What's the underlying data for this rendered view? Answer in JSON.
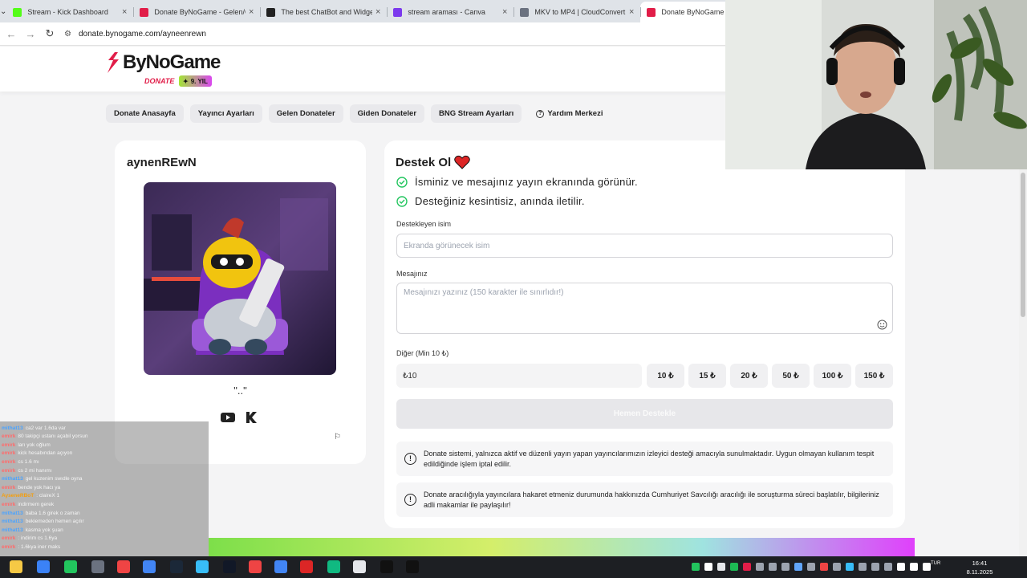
{
  "browser": {
    "tabs": [
      {
        "title": "Stream - Kick Dashboard",
        "favicon_color": "#53fc18",
        "active": false
      },
      {
        "title": "Donate ByNoGame - Gelen/Giden",
        "favicon_color": "#e11d48",
        "active": false
      },
      {
        "title": "The best ChatBot and Widgets",
        "favicon_color": "#222222",
        "active": false
      },
      {
        "title": "stream araması - Canva",
        "favicon_color": "#7c3aed",
        "active": false
      },
      {
        "title": "MKV to MP4 | CloudConvert",
        "favicon_color": "#6b7280",
        "active": false
      },
      {
        "title": "Donate ByNoGame",
        "favicon_color": "#e11d48",
        "active": true
      }
    ],
    "url": "donate.bynogame.com/ayneenrewn"
  },
  "header": {
    "logo_text": "ByNoGame",
    "logo_sub": "DONATE",
    "badge": "9. YIL"
  },
  "nav": [
    {
      "label": "Donate Anasayfa"
    },
    {
      "label": "Yayıncı Ayarları"
    },
    {
      "label": "Gelen Donateler"
    },
    {
      "label": "Giden Donateler"
    },
    {
      "label": "BNG Stream Ayarları"
    },
    {
      "label": "Yardım Merkezi",
      "icon": "question-circle-icon"
    }
  ],
  "profile": {
    "name": "aynenREwN",
    "bio": "\"..\"",
    "socials": [
      "youtube-icon",
      "kick-icon"
    ]
  },
  "donate": {
    "title": "Destek Ol",
    "checks": [
      "İsminiz ve mesajınız yayın ekranında görünür.",
      "Desteğiniz kesintisiz, anında iletilir."
    ],
    "name_label": "Destekleyen isim",
    "name_placeholder": "Ekranda görünecek isim",
    "message_label": "Mesajınız",
    "message_placeholder": "Mesajınızı yazınız (150 karakter ile sınırlıdır!)",
    "amount_label": "Diğer (Min 10 ₺)",
    "amount_value": "₺10",
    "amount_chips": [
      "10 ₺",
      "15 ₺",
      "20 ₺",
      "50 ₺",
      "100 ₺",
      "150 ₺"
    ],
    "submit_label": "Hemen Destekle",
    "notices": [
      "Donate sistemi, yalnızca aktif ve düzenli yayın yapan yayıncılarımızın izleyici desteği amacıyla sunulmaktadır. Uygun olmayan kullanım tespit edildiğinde işlem iptal edilir.",
      "Donate aracılığıyla yayıncılara hakaret etmeniz durumunda hakkınızda Cumhuriyet Savcılığı aracılığı ile soruşturma süreci başlatılır, bilgileriniz adli makamlar ile paylaşılır!"
    ]
  },
  "chat": [
    {
      "user": "",
      "msg": "ca2 var 1.6da var",
      "color": "#e6b800"
    },
    {
      "user": "mithat13",
      "msg": "ca2 var 1.6da var",
      "color": "#4aa3ff"
    },
    {
      "user": "emirk",
      "msg": "80 takipçi ustanı açabil yorsun",
      "color": "#ff6b6b"
    },
    {
      "user": "emirk",
      "msg": "ları yok oğlum",
      "color": "#ff6b6b"
    },
    {
      "user": "emirk",
      "msg": "kick hesabından açıyon",
      "color": "#ff6b6b"
    },
    {
      "user": "emirk",
      "msg": "cs 1.6 mı",
      "color": "#ff6b6b"
    },
    {
      "user": "emirk",
      "msg": "cs 2 mi hanımı",
      "color": "#ff6b6b"
    },
    {
      "user": "mithat13",
      "msg": "gel kuzenim swıdle oyna",
      "color": "#4aa3ff"
    },
    {
      "user": "emirk",
      "msg": "bende yok hacı ya",
      "color": "#ff6b6b"
    },
    {
      "user": "AyseneRBoT",
      "msg": ": claireX 1",
      "color": "#f59e0b"
    },
    {
      "user": "emirk",
      "msg": "indirmem gerek",
      "color": "#ff6b6b"
    },
    {
      "user": "mithat13",
      "msg": "baba 1.6 girek o zaman",
      "color": "#4aa3ff"
    },
    {
      "user": "mithat13",
      "msg": "bekiemeden hemen açılır",
      "color": "#4aa3ff"
    },
    {
      "user": "mithat13",
      "msg": "kasma yok şuan",
      "color": "#4aa3ff"
    },
    {
      "user": "emirk",
      "msg": ": indirim cs 1.6ya",
      "color": "#ff6b6b"
    },
    {
      "user": "emirk",
      "msg": ": 1.6kya iner maks",
      "color": "#ff6b6b"
    }
  ],
  "taskbar": {
    "time": "16:41",
    "date": "8.11.2025",
    "lang": "TUR"
  }
}
